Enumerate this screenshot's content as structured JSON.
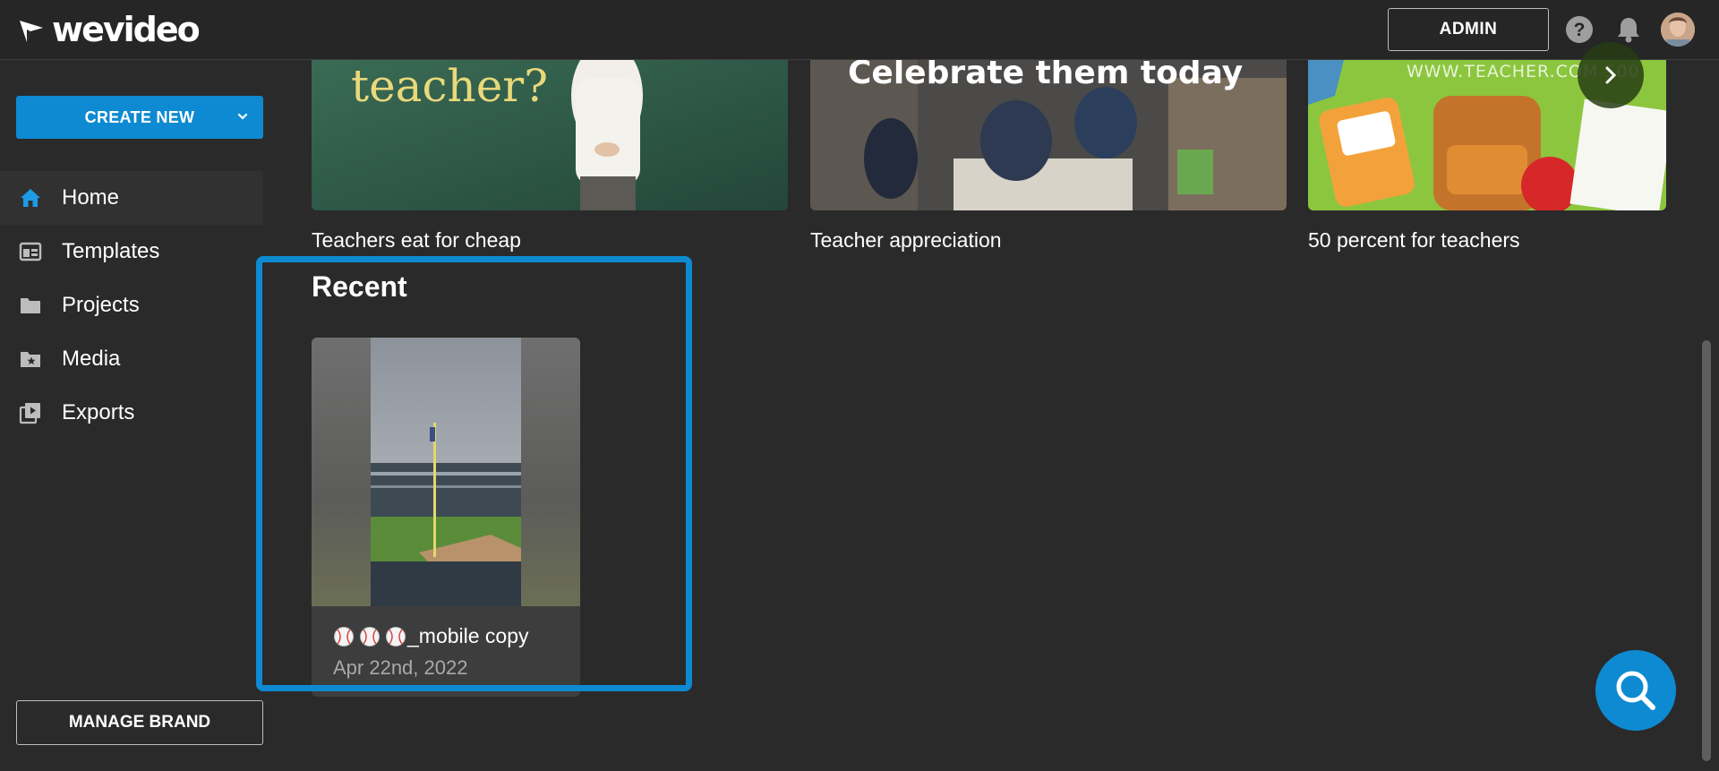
{
  "app": {
    "logo_text": "wevideo"
  },
  "topbar": {
    "admin_label": "ADMIN",
    "icons": [
      "help-icon",
      "bell-icon",
      "avatar"
    ]
  },
  "sidebar": {
    "create_label": "CREATE NEW",
    "items": [
      {
        "label": "Home",
        "icon": "home-icon",
        "active": true
      },
      {
        "label": "Templates",
        "icon": "templates-icon",
        "active": false
      },
      {
        "label": "Projects",
        "icon": "folder-icon",
        "active": false
      },
      {
        "label": "Media",
        "icon": "media-folder-icon",
        "active": false
      },
      {
        "label": "Exports",
        "icon": "exports-icon",
        "active": false
      }
    ],
    "manage_label": "MANAGE BRAND"
  },
  "featured": {
    "cards": [
      {
        "title": "Teachers eat for cheap",
        "overlay_text": "teacher?"
      },
      {
        "title": "Teacher appreciation",
        "overlay_text": "Celebrate them today"
      },
      {
        "title": "50 percent for teachers",
        "overlay_text": "WWW.TEACHER.COM 500"
      }
    ]
  },
  "recent": {
    "heading": "Recent",
    "items": [
      {
        "name": "_mobile copy",
        "date": "Apr 22nd, 2022",
        "emoji_count": 3
      }
    ]
  },
  "colors": {
    "accent": "#0d8ad1",
    "background": "#2a2a2a",
    "topbar": "#262626"
  }
}
